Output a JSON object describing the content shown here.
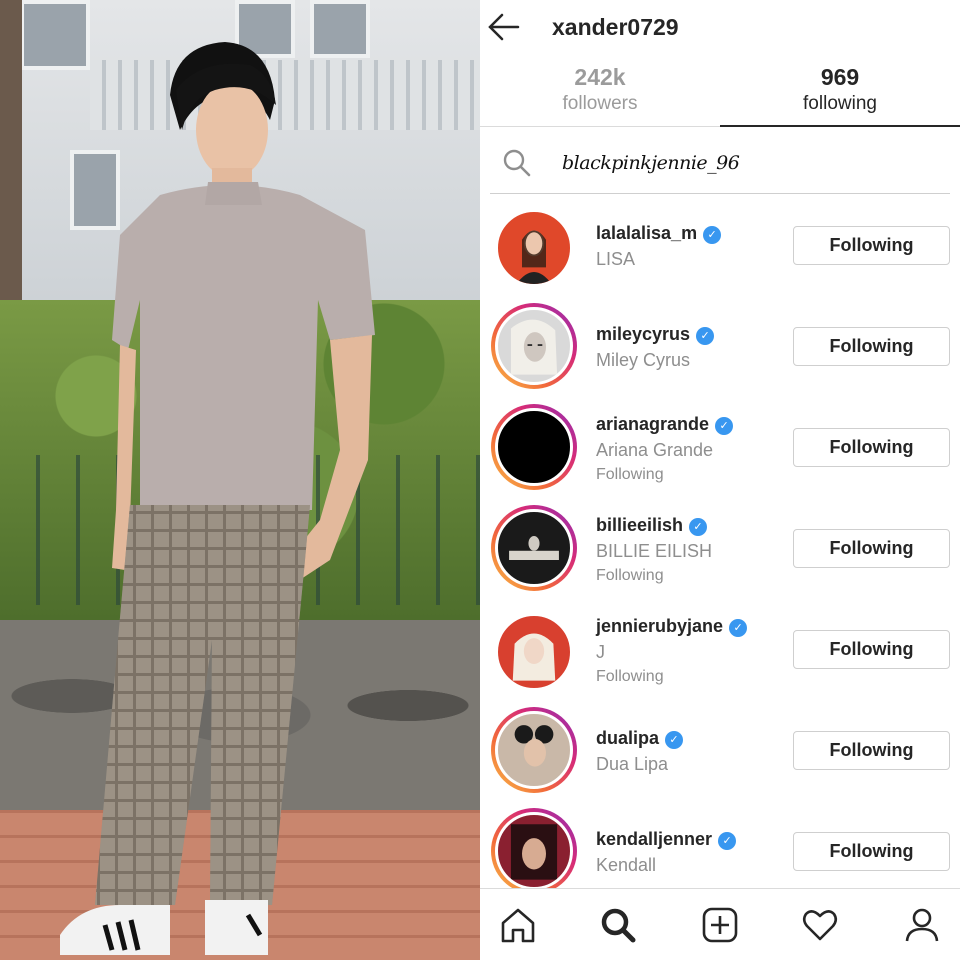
{
  "header": {
    "username": "xander0729"
  },
  "tabs": {
    "followers": {
      "count": "242k",
      "label": "followers"
    },
    "following": {
      "count": "969",
      "label": "following"
    }
  },
  "search": {
    "value": "blackpinkjennie_96"
  },
  "following_list": [
    {
      "username": "lalalalisa_m",
      "name": "LISA",
      "sub": "",
      "button": "Following",
      "verified": true,
      "story": false,
      "avatar_color": "#e0482a"
    },
    {
      "username": "mileycyrus",
      "name": "Miley Cyrus",
      "sub": "",
      "button": "Following",
      "verified": true,
      "story": true,
      "avatar_color": "#d9d9d9"
    },
    {
      "username": "arianagrande",
      "name": "Ariana Grande",
      "sub": "Following",
      "button": "Following",
      "verified": true,
      "story": true,
      "avatar_color": "#000000"
    },
    {
      "username": "billieeilish",
      "name": "BILLIE EILISH",
      "sub": "Following",
      "button": "Following",
      "verified": true,
      "story": true,
      "avatar_color": "#1a1a1a"
    },
    {
      "username": "jennierubyjane",
      "name": "J",
      "sub": "Following",
      "button": "Following",
      "verified": true,
      "story": false,
      "avatar_color": "#d8402f"
    },
    {
      "username": "dualipa",
      "name": "Dua Lipa",
      "sub": "",
      "button": "Following",
      "verified": true,
      "story": true,
      "avatar_color": "#c9b8a8"
    },
    {
      "username": "kendalljenner",
      "name": "Kendall",
      "sub": "",
      "button": "Following",
      "verified": true,
      "story": true,
      "avatar_color": "#8a2030"
    }
  ],
  "colors": {
    "verified": "#3897f0",
    "text_primary": "#262626",
    "text_secondary": "#8e8e8e",
    "divider": "#dbdbdb"
  },
  "navbar": {
    "icons": [
      "home-icon",
      "search-icon",
      "add-post-icon",
      "heart-icon",
      "profile-icon"
    ]
  }
}
